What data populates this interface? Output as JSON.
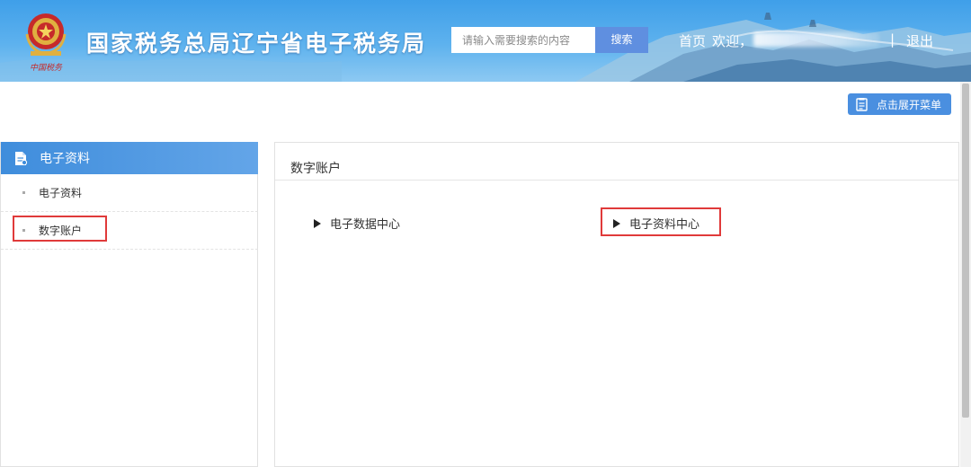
{
  "header": {
    "site_title": "国家税务总局辽宁省电子税务局",
    "search_placeholder": "请输入需要搜索的内容",
    "search_button": "搜索",
    "nav_home": "首页",
    "nav_welcome": "欢迎，",
    "nav_separator": "|",
    "nav_logout": "退出",
    "emblem_icon": "tax-bureau-emblem-icon",
    "emblem_caption": "中国税务",
    "colors": {
      "banner_top": "#3f9fe9",
      "banner_bottom": "#8dc9f2",
      "search_button_bg": "#5f8fe0"
    }
  },
  "toolbar": {
    "expand_menu_label": "点击展开菜单",
    "expand_menu_icon": "menu-document-icon",
    "button_color": "#4a8fe0"
  },
  "sidebar": {
    "header_label": "电子资料",
    "header_icon": "document-file-icon",
    "items": [
      {
        "label": "电子资料"
      },
      {
        "label": "数字账户",
        "highlighted": true
      }
    ],
    "header_color": "#3f8ddc"
  },
  "main": {
    "title": "数字账户",
    "links": [
      {
        "label": "电子数据中心",
        "icon": "triangle-right-icon"
      },
      {
        "label": "电子资料中心",
        "icon": "triangle-right-icon",
        "highlighted": true
      }
    ],
    "highlight_color": "#e03a3a"
  }
}
